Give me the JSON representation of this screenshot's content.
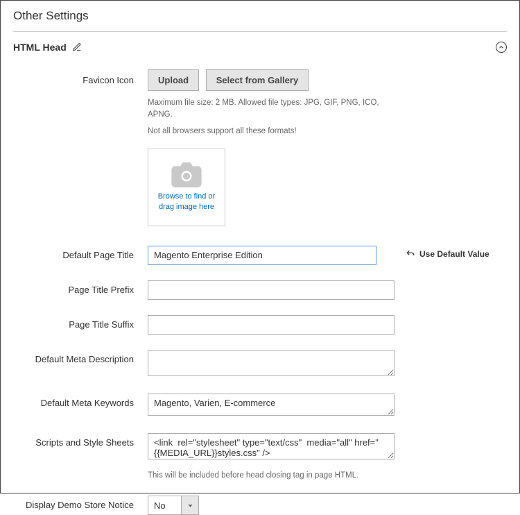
{
  "panel_title": "Other Settings",
  "section": {
    "title": "HTML Head"
  },
  "favicon": {
    "label": "Favicon Icon",
    "upload_btn": "Upload",
    "gallery_btn": "Select from Gallery",
    "hint1": "Maximum file size: 2 MB. Allowed file types: JPG, GIF, PNG, ICO, APNG.",
    "hint2": "Not all browsers support all these formats!",
    "browse_text": "Browse to find or drag image here"
  },
  "default_page_title": {
    "label": "Default Page Title",
    "value": "Magento Enterprise Edition",
    "use_default": "Use Default Value"
  },
  "page_title_prefix": {
    "label": "Page Title Prefix",
    "value": ""
  },
  "page_title_suffix": {
    "label": "Page Title Suffix",
    "value": ""
  },
  "meta_description": {
    "label": "Default Meta Description",
    "value": ""
  },
  "meta_keywords": {
    "label": "Default Meta Keywords",
    "value": "Magento, Varien, E-commerce"
  },
  "scripts": {
    "label": "Scripts and Style Sheets",
    "value": "<link  rel=\"stylesheet\" type=\"text/css\"  media=\"all\" href=\"{{MEDIA_URL}}styles.css\" />",
    "hint": "This will be included before head closing tag in page HTML."
  },
  "demo_notice": {
    "label": "Display Demo Store Notice",
    "selected": "No"
  }
}
